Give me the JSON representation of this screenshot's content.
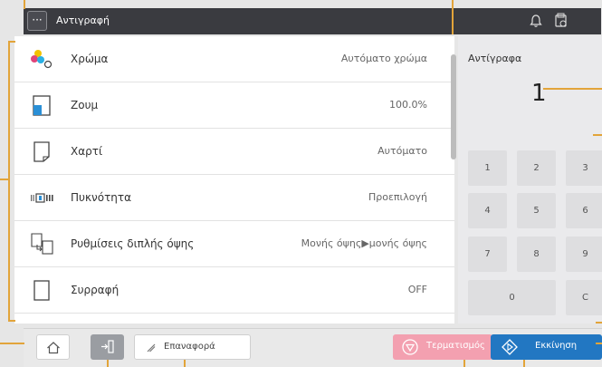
{
  "header": {
    "menu_glyph": "···",
    "title": "Αντιγραφή"
  },
  "settings": [
    {
      "label": "Χρώμα",
      "value": "Αυτόματο χρώμα",
      "icon": "color-icon"
    },
    {
      "label": "Ζουμ",
      "value": "100.0%",
      "icon": "zoom-icon"
    },
    {
      "label": "Χαρτί",
      "value": "Αυτόματο",
      "icon": "paper-icon"
    },
    {
      "label": "Πυκνότητα",
      "value": "Προεπιλογή",
      "icon": "density-icon"
    },
    {
      "label": "Ρυθμίσεις διπλής όψης",
      "value": "Μονής όψης▶μονής όψης",
      "icon": "duplex-icon"
    },
    {
      "label": "Συρραφή",
      "value": "OFF",
      "icon": "binding-icon"
    }
  ],
  "copies": {
    "label": "Αντίγραφα",
    "value": "1"
  },
  "keypad": [
    "1",
    "2",
    "3",
    "4",
    "5",
    "6",
    "7",
    "8",
    "9",
    "0",
    "C"
  ],
  "footer": {
    "reset_label": "Επαναφορά",
    "stop_label": "Τερματισμός",
    "start_label": "Εκκίνηση"
  },
  "colors": {
    "header": "#3a3b40",
    "start": "#2277c2",
    "stop": "#f3a0b0",
    "annotation": "#e2a43a"
  }
}
